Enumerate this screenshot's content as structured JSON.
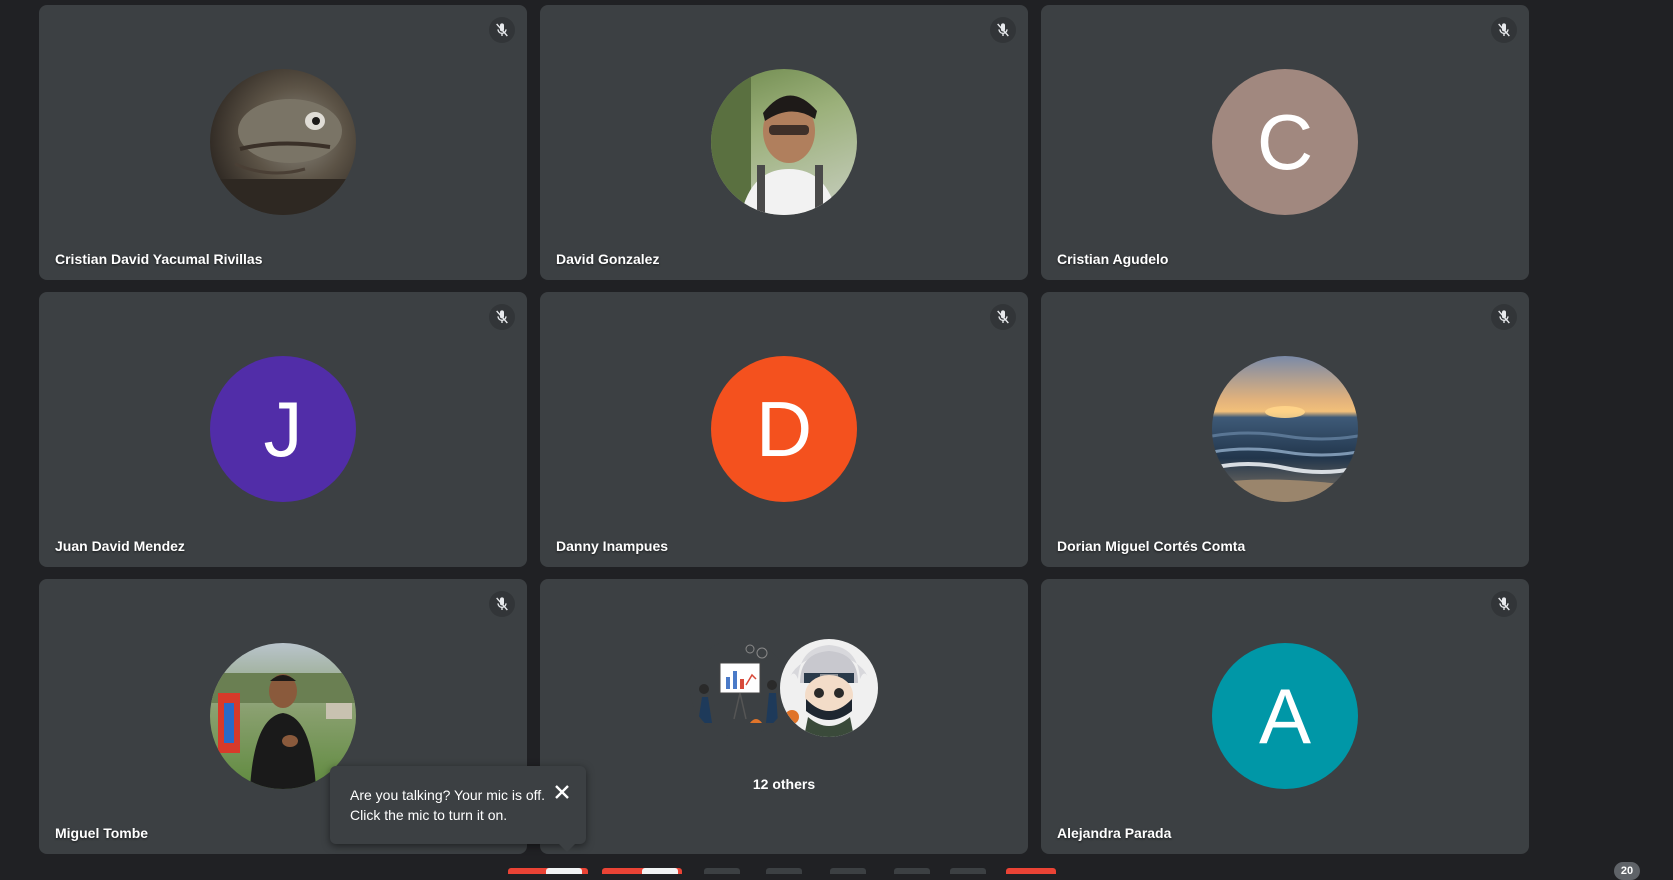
{
  "participants": [
    {
      "name": "Cristian David Yacumal Rivillas",
      "avatar_type": "photo",
      "photo_subject": "turtle-photo",
      "muted": true
    },
    {
      "name": "David Gonzalez",
      "avatar_type": "photo",
      "photo_subject": "man-selfie-photo",
      "muted": true
    },
    {
      "name": "Cristian Agudelo",
      "avatar_type": "initial",
      "initial": "C",
      "avatar_color": "#a1887f",
      "muted": true
    },
    {
      "name": "Juan David Mendez",
      "avatar_type": "initial",
      "initial": "J",
      "avatar_color": "#512da8",
      "muted": true
    },
    {
      "name": "Danny Inampues",
      "avatar_type": "initial",
      "initial": "D",
      "avatar_color": "#f4511e",
      "muted": true
    },
    {
      "name": "Dorian Miguel Cortés Comta",
      "avatar_type": "photo",
      "photo_subject": "sunset-sea-photo",
      "muted": true
    },
    {
      "name": "Miguel Tombe",
      "avatar_type": "photo",
      "photo_subject": "man-park-photo",
      "muted": true
    },
    {
      "name": "12 others",
      "avatar_type": "group",
      "muted": false
    },
    {
      "name": "Alejandra Parada",
      "avatar_type": "initial",
      "initial": "A",
      "avatar_color": "#0097a7",
      "muted": true
    }
  ],
  "tooltip": {
    "message": "Are you talking? Your mic is off. Click the mic to turn it on.",
    "close_icon": "close-icon"
  },
  "participant_count_badge": "20",
  "colors": {
    "background": "#202124",
    "tile": "#3c4043",
    "text": "#ffffff"
  }
}
